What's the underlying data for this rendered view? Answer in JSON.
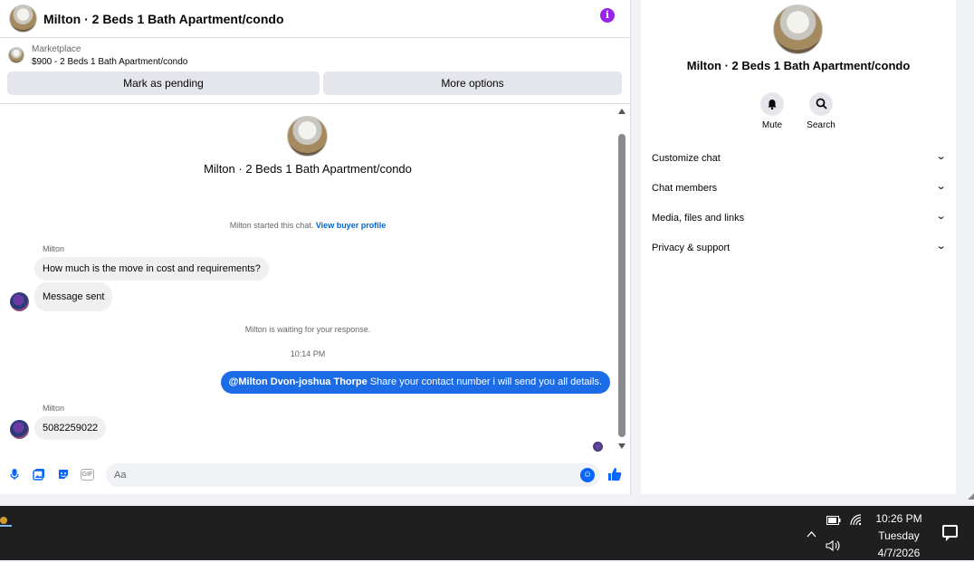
{
  "header": {
    "title": "Milton · 2 Beds 1 Bath Apartment/condo",
    "info_icon": "info-icon",
    "accent": "#9b22e8"
  },
  "listing": {
    "category": "Marketplace",
    "price_title": "$900 - 2 Beds 1 Bath Apartment/condo",
    "pending_label": "Mark as pending",
    "more_label": "More options"
  },
  "conversation": {
    "intro_title": "Milton · 2 Beds 1 Bath Apartment/condo",
    "started_text": "Milton started this chat.",
    "buyer_link": "View buyer profile",
    "sender1": "Milton",
    "msg1": "How much is the move in cost and requirements?",
    "msg2": "Message sent",
    "waiting_text": "Milton is waiting for your response.",
    "timestamp": "10:14 PM",
    "out_mention": "@Milton Dvon-joshua Thorpe",
    "out_text": "Share your contact number i will send you all details.",
    "sender2": "Milton",
    "msg3": "5082259022"
  },
  "composer": {
    "placeholder": "Aa",
    "icons": [
      "microphone-icon",
      "photo-icon",
      "sticker-icon",
      "gif-icon",
      "emoji-icon",
      "thumbs-up-icon"
    ],
    "gif_label": "GIF"
  },
  "side": {
    "title": "Milton · 2 Beds 1 Bath Apartment/condo",
    "mute_label": "Mute",
    "search_label": "Search",
    "sections": [
      "Customize chat",
      "Chat members",
      "Media, files and links",
      "Privacy & support"
    ]
  },
  "taskbar": {
    "time": "10:26 PM",
    "day": "Tuesday",
    "date": "4/7/2026"
  },
  "colors": {
    "brand": "#0866ff",
    "outgoing": "#1d6ce7",
    "bubble": "#f0f0f0"
  }
}
